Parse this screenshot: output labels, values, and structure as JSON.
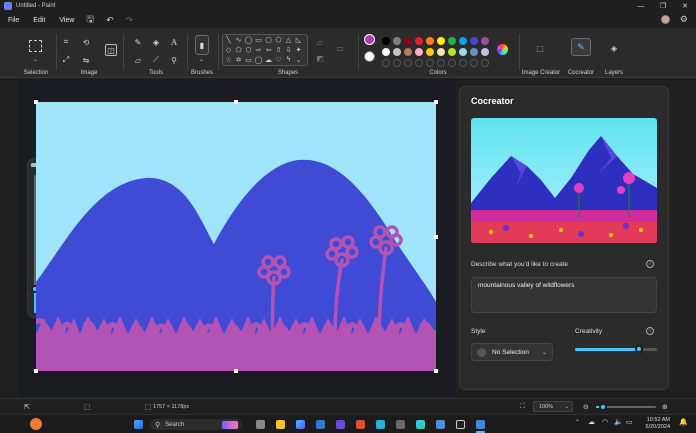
{
  "window": {
    "title": "Untitled - Paint"
  },
  "menu": {
    "file": "File",
    "edit": "Edit",
    "view": "View"
  },
  "ribbon": {
    "groups": {
      "selection": "Selection",
      "image": "Image",
      "tools": "Tools",
      "brushes": "Brushes",
      "shapes": "Shapes",
      "colors": "Colors",
      "image_creator": "Image Creator",
      "cocreator": "Cocreator",
      "layers": "Layers"
    },
    "text_tool_glyph": "A",
    "colors": {
      "active_primary": "#b23ab6",
      "active_secondary": "#ffffff",
      "row1": [
        "#000000",
        "#7f7f7f",
        "#880015",
        "#ed1c24",
        "#ff7f27",
        "#fff200",
        "#22b14c",
        "#00a2e8",
        "#3f48cc",
        "#a349a4"
      ],
      "row2": [
        "#ffffff",
        "#c3c3c3",
        "#b97a57",
        "#ffaec9",
        "#ffc90e",
        "#efe4b0",
        "#b5e61d",
        "#99d9ea",
        "#7092be",
        "#c8bfe7"
      ]
    }
  },
  "canvas": {
    "sky_color": "#9fe4f8",
    "mountain_color": "#3f4bd4",
    "flower_color": "#b354b4"
  },
  "cocreator": {
    "title": "Cocreator",
    "describe_label": "Describe what you'd like to create",
    "prompt": "mountainous valley of wildflowers",
    "style_label": "Style",
    "style_value": "No Selection",
    "creativity_label": "Creativity",
    "creativity_level": 0.78
  },
  "status": {
    "dimensions": "1757 × 1178px",
    "zoom": "100%"
  },
  "taskbar": {
    "search": "Search",
    "time": "10:52 AM",
    "date": "5/20/2024"
  }
}
